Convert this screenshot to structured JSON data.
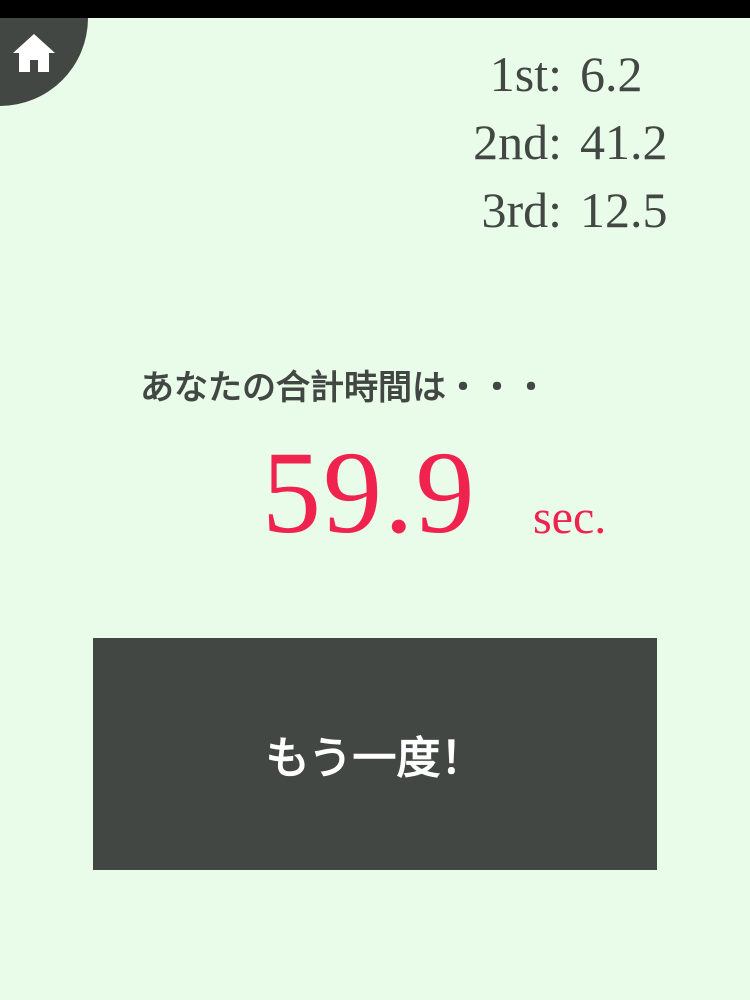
{
  "theme": {
    "background": "#e9fbe9",
    "dark": "#434743",
    "accent": "#f0234f"
  },
  "home": {
    "icon": "home-icon"
  },
  "scores": [
    {
      "label": "1st:",
      "value": "6.2"
    },
    {
      "label": "2nd:",
      "value": "41.2"
    },
    {
      "label": "3rd:",
      "value": "12.5"
    }
  ],
  "total": {
    "label": "あなたの合計時間は・・・",
    "value": "59.9",
    "unit": "sec."
  },
  "retry": {
    "label": "もう一度！"
  }
}
